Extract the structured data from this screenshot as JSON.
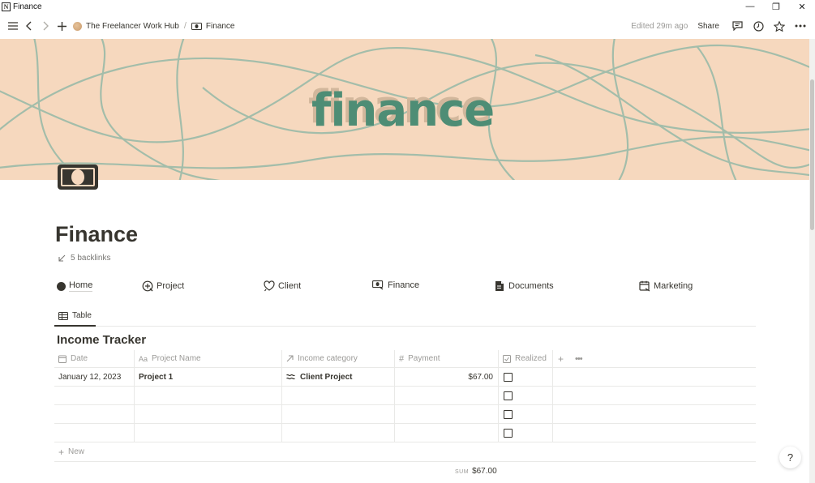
{
  "window": {
    "title": "Finance",
    "minimize": "—",
    "restore": "❐",
    "close": "✕"
  },
  "topbar": {
    "breadcrumb": [
      {
        "label": "The Freelancer Work Hub"
      },
      {
        "label": "Finance"
      }
    ],
    "separator": "/",
    "edited": "Edited 29m ago",
    "share": "Share"
  },
  "cover": {
    "text": "finance",
    "background": "#f6d8be",
    "line_color": "#8fb8a6",
    "text_color": "#4e8d75"
  },
  "page": {
    "title": "Finance",
    "backlinks": "5 backlinks"
  },
  "nav": [
    {
      "label": "Home",
      "icon": "filled-circle-icon"
    },
    {
      "label": "Project",
      "icon": "plus-circle-icon"
    },
    {
      "label": "Client",
      "icon": "heart-speech-icon"
    },
    {
      "label": "Finance",
      "icon": "money-icon"
    },
    {
      "label": "Documents",
      "icon": "document-icon"
    },
    {
      "label": "Marketing",
      "icon": "calendar-arrow-icon"
    }
  ],
  "views": [
    {
      "label": "Table",
      "icon": "table-icon",
      "active": true
    }
  ],
  "database": {
    "title": "Income Tracker",
    "columns": [
      {
        "label": "Date",
        "icon": "calendar-icon"
      },
      {
        "label": "Project Name",
        "icon": "text-icon"
      },
      {
        "label": "Income category",
        "icon": "relation-arrow-icon"
      },
      {
        "label": "Payment",
        "icon": "hash-icon"
      },
      {
        "label": "Realized",
        "icon": "checkbox-icon"
      }
    ],
    "rows": [
      {
        "date": "January 12, 2023",
        "project": "Project 1",
        "category": "Client Project",
        "payment": "$67.00",
        "realized": false
      },
      {
        "date": "",
        "project": "",
        "category": "",
        "payment": "",
        "realized": false
      },
      {
        "date": "",
        "project": "",
        "category": "",
        "payment": "",
        "realized": false
      },
      {
        "date": "",
        "project": "",
        "category": "",
        "payment": "",
        "realized": false
      }
    ],
    "new_label": "New",
    "sum_label": "SUM",
    "sum_value": "$67.00"
  },
  "help": "?"
}
